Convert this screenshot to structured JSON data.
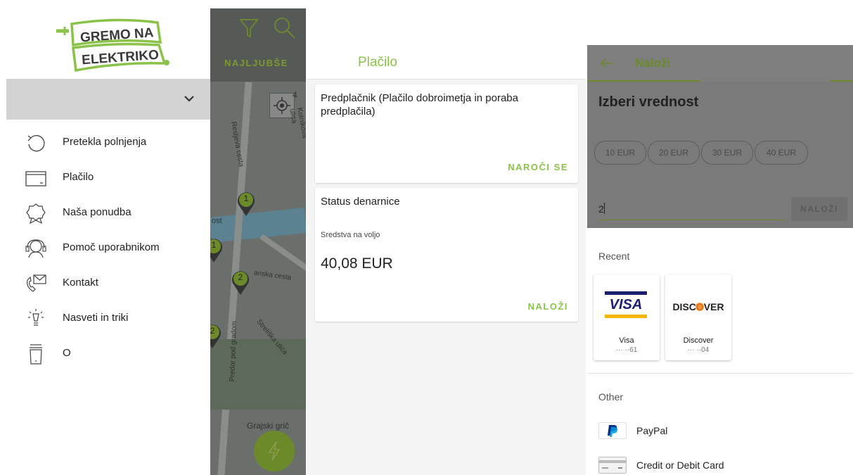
{
  "brand": {
    "logo_line1": "GREMO NA",
    "logo_line2": "ELEKTRIKO",
    "accent": "#8bc34a",
    "dark_accent": "#6d8a2a"
  },
  "drawer": {
    "items": [
      {
        "label": "Pretekla polnjenja",
        "icon": "history-icon"
      },
      {
        "label": "Plačilo",
        "icon": "wallet-icon"
      },
      {
        "label": "Naša ponudba",
        "icon": "badge-icon"
      },
      {
        "label": "Pomoč uporabnikom",
        "icon": "support-icon"
      },
      {
        "label": "Kontakt",
        "icon": "mail-icon"
      },
      {
        "label": "Nasveti in triki",
        "icon": "lightbulb-icon"
      },
      {
        "label": "O",
        "icon": "cup-icon"
      }
    ]
  },
  "map": {
    "tab_label": "NAJLJUBŠE",
    "street_labels": [
      "Resljeva cesta",
      "Kotnikova ulica",
      "ost",
      "anska cesta",
      "Streliška ulica",
      "Predor pod gradom",
      "Grajski grič"
    ],
    "markers": [
      "1",
      "1",
      "2",
      "2"
    ],
    "compass_label": "4"
  },
  "payment": {
    "title": "Plačilo",
    "subscription_card": {
      "title": "Predplačnik (Plačilo dobroimetja in poraba predplačila)",
      "action": "NAROČI SE"
    },
    "wallet_card": {
      "title": "Status denarnice",
      "balance_label": "Sredstva na voljo",
      "balance": "40,08 EUR",
      "action": "NALOŽI"
    }
  },
  "topup": {
    "title": "Naloži",
    "heading": "Izberi vrednost",
    "chips": [
      "10 EUR",
      "20 EUR",
      "30 EUR",
      "40 EUR"
    ],
    "input_value": "2",
    "submit_label": "NALOŽI",
    "recent_label": "Recent",
    "recent_cards": [
      {
        "name": "Visa",
        "digits": "··· ··61",
        "logo": "VISA"
      },
      {
        "name": "Discover",
        "digits": "··· ··04",
        "logo": "DISCOVER"
      }
    ],
    "other_label": "Other",
    "other_methods": [
      {
        "label": "PayPal",
        "icon": "paypal-icon"
      },
      {
        "label": "Credit or Debit Card",
        "icon": "credit-card-icon"
      }
    ]
  }
}
